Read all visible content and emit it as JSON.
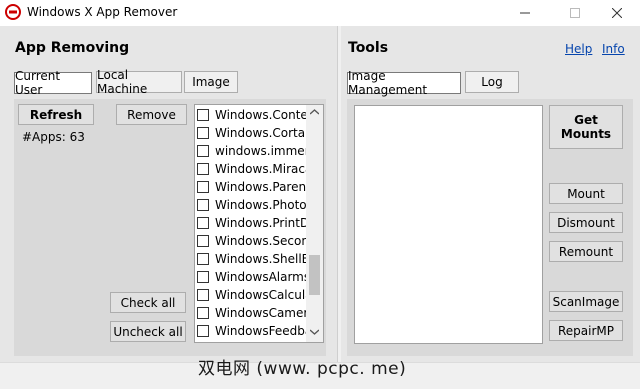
{
  "window": {
    "title": "Windows X App Remover"
  },
  "left": {
    "heading": "App Removing",
    "tabs": [
      "Current User",
      "Local Machine",
      "Image"
    ],
    "refresh_label": "Refresh",
    "remove_label": "Remove",
    "apps_count": "#Apps: 63",
    "check_all_label": "Check all",
    "uncheck_all_label": "Uncheck all",
    "apps": [
      "Windows.ContentDeliveryManager",
      "Windows.Cortana",
      "windows.immersivecontrolpanel",
      "Windows.MiracastView",
      "Windows.ParentalControls",
      "Windows.Photos",
      "Windows.PrintDialog",
      "Windows.SecondaryTileExperience",
      "Windows.ShellExperienceHost",
      "WindowsAlarms",
      "WindowsCalculator",
      "WindowsCamera",
      "WindowsFeedbackHub"
    ]
  },
  "right": {
    "heading": "Tools",
    "help_label": "Help",
    "info_label": "Info",
    "tabs": [
      "Image Management",
      "Log"
    ],
    "get_mounts_label": "Get\nMounts",
    "mount_label": "Mount",
    "dismount_label": "Dismount",
    "remount_label": "Remount",
    "scanimage_label": "ScanImage",
    "repairmp_label": "RepairMP"
  },
  "watermark": "双电网 (www. pcpc. me)"
}
